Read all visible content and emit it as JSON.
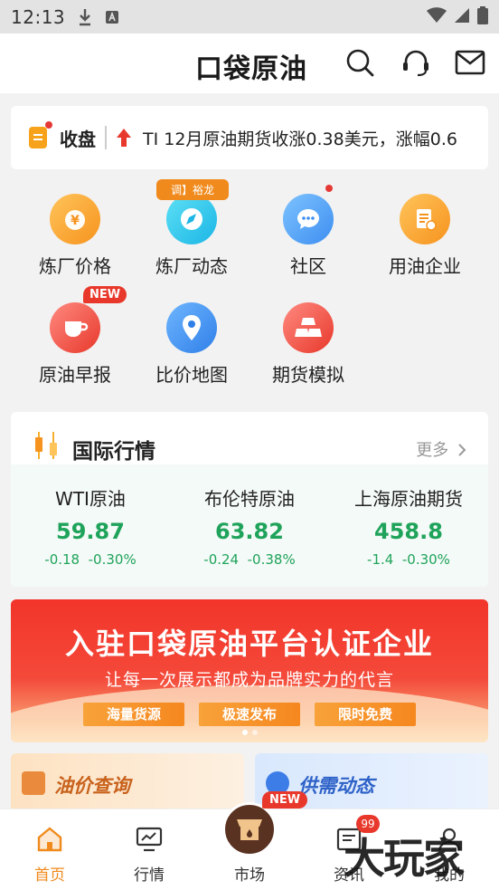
{
  "status_bar": {
    "time": "12:13"
  },
  "header": {
    "app_name": "口袋原油"
  },
  "ticker": {
    "title": "收盘",
    "text": "TI 12月原油期货收涨0.38美元，涨幅0.6"
  },
  "grid": [
    {
      "label": "炼厂价格",
      "icon": "yuan-bag-icon"
    },
    {
      "label": "炼厂动态",
      "icon": "compass-icon",
      "tag": "调】裕龙"
    },
    {
      "label": "社区",
      "icon": "chat-icon",
      "dot": true
    },
    {
      "label": "用油企业",
      "icon": "document-icon"
    },
    {
      "label": "原油早报",
      "icon": "cup-icon",
      "badge": "NEW"
    },
    {
      "label": "比价地图",
      "icon": "map-pin-icon"
    },
    {
      "label": "期货模拟",
      "icon": "gold-bars-icon"
    }
  ],
  "market": {
    "title": "国际行情",
    "more": "更多",
    "quotes": [
      {
        "name": "WTI原油",
        "price": "59.87",
        "change": "-0.18",
        "pct": "-0.30%"
      },
      {
        "name": "布伦特原油",
        "price": "63.82",
        "change": "-0.24",
        "pct": "-0.38%"
      },
      {
        "name": "上海原油期货",
        "price": "458.8",
        "change": "-1.4",
        "pct": "-0.30%"
      }
    ],
    "colors": {
      "down": "#1fa35b"
    }
  },
  "banner": {
    "title": "入驻口袋原油平台认证企业",
    "subtitle": "让每一次展示都成为品牌实力的代言",
    "pills": [
      "海量货源",
      "极速发布",
      "限时免费"
    ]
  },
  "cards": [
    {
      "title": "油价查询"
    },
    {
      "title": "供需动态"
    }
  ],
  "tabbar": {
    "items": [
      {
        "label": "首页",
        "icon": "home-icon",
        "active": true
      },
      {
        "label": "行情",
        "icon": "chart-icon"
      },
      {
        "label": "市场",
        "icon": "market-icon"
      },
      {
        "label": "资讯",
        "icon": "news-icon"
      },
      {
        "label": "我的",
        "icon": "profile-icon"
      }
    ],
    "market_badge": "NEW",
    "news_count": "99",
    "accent": "#f08a1c"
  },
  "watermark": "大玩家"
}
